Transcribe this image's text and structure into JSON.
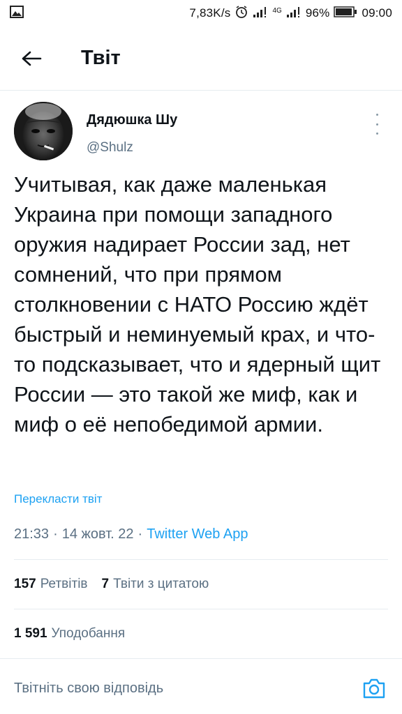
{
  "status_bar": {
    "network_speed": "7,83K/s",
    "network_type": "4G",
    "battery_percent": "96%",
    "battery_level": 0.96,
    "time": "09:00"
  },
  "header": {
    "title": "Твіт"
  },
  "tweet": {
    "author_name": "Дядюшка Шу",
    "author_handle": "@Shulz",
    "text": "Учитывая, как даже маленькая Украина при помощи западного оружия надирает России зад, нет сомнений, что при прямом столкновении с НАТО Россию ждёт быстрый и неминуемый крах, и что-то подсказывает, что и ядерный щит России — это такой же миф, как и миф о её непобедимой армии.",
    "translate_label": "Перекласти твіт",
    "time": "21:33",
    "separator": "·",
    "date": "14 жовт. 22",
    "source": "Twitter Web App"
  },
  "stats": {
    "retweets_count": "157",
    "retweets_label": "Ретвітів",
    "quotes_count": "7",
    "quotes_label": "Твіти з цитатою",
    "likes_count": "1 591",
    "likes_label": "Уподобання"
  },
  "reply": {
    "placeholder": "Твітніть свою відповідь"
  },
  "colors": {
    "accent": "#1da1f2",
    "text_primary": "#0f1419",
    "text_secondary": "#5b7083",
    "divider": "#e6ecf0"
  }
}
